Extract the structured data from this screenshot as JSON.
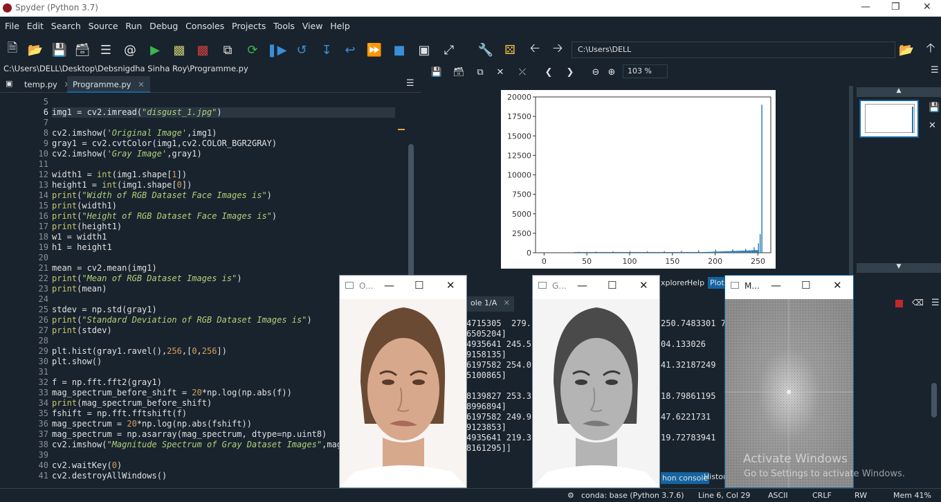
{
  "window": {
    "title": "Spyder (Python 3.7)"
  },
  "menu": [
    "File",
    "Edit",
    "Search",
    "Source",
    "Run",
    "Debug",
    "Consoles",
    "Projects",
    "Tools",
    "View",
    "Help"
  ],
  "toolbar": {
    "path": "C:\\Users\\DELL"
  },
  "editor": {
    "path": "C:\\Users\\DELL\\Desktop\\Debsnigdha Sinha Roy\\Programme.py",
    "tabs": [
      "temp.py",
      "Programme.py"
    ],
    "lines": [
      {
        "n": "5",
        "t": ""
      },
      {
        "n": "6",
        "t": "img1 = cv2.imread(\"disgust_1.jpg\")"
      },
      {
        "n": "7",
        "t": ""
      },
      {
        "n": "8",
        "t": "cv2.imshow('Original Image',img1)"
      },
      {
        "n": "9",
        "t": "gray1 = cv2.cvtColor(img1,cv2.COLOR_BGR2GRAY)"
      },
      {
        "n": "10",
        "t": "cv2.imshow('Gray Image',gray1)"
      },
      {
        "n": "11",
        "t": ""
      },
      {
        "n": "12",
        "t": "width1 = int(img1.shape[1])"
      },
      {
        "n": "13",
        "t": "height1 = int(img1.shape[0])"
      },
      {
        "n": "14",
        "t": "print(\"Width of RGB Dataset Face Images is\")"
      },
      {
        "n": "15",
        "t": "print(width1)"
      },
      {
        "n": "16",
        "t": "print(\"Height of RGB Dataset Face Images is\")"
      },
      {
        "n": "17",
        "t": "print(height1)"
      },
      {
        "n": "18",
        "t": "w1 = width1"
      },
      {
        "n": "19",
        "t": "h1 = height1"
      },
      {
        "n": "20",
        "t": ""
      },
      {
        "n": "21",
        "t": "mean = cv2.mean(img1)"
      },
      {
        "n": "22",
        "t": "print(\"Mean of RGB Dataset Images is\")"
      },
      {
        "n": "23",
        "t": "print(mean)"
      },
      {
        "n": "24",
        "t": ""
      },
      {
        "n": "25",
        "t": "stdev = np.std(gray1)"
      },
      {
        "n": "26",
        "t": "print(\"Standard Deviation of RGB Dataset Images is\")"
      },
      {
        "n": "27",
        "t": "print(stdev)"
      },
      {
        "n": "28",
        "t": ""
      },
      {
        "n": "29",
        "t": "plt.hist(gray1.ravel(),256,[0,256])"
      },
      {
        "n": "30",
        "t": "plt.show()"
      },
      {
        "n": "31",
        "t": ""
      },
      {
        "n": "32",
        "t": "f = np.fft.fft2(gray1)"
      },
      {
        "n": "33",
        "t": "mag_spectrum_before_shift = 20*np.log(np.abs(f))"
      },
      {
        "n": "34",
        "t": "print(mag_spectrum_before_shift)"
      },
      {
        "n": "35",
        "t": "fshift = np.fft.fftshift(f)"
      },
      {
        "n": "36",
        "t": "mag_spectrum = 20*np.log(np.abs(fshift))"
      },
      {
        "n": "37",
        "t": "mag_spectrum = np.asarray(mag_spectrum, dtype=np.uint8)"
      },
      {
        "n": "38",
        "t": "cv2.imshow(\"Magnitude Spectrum of Gray Dataset Images\",mag_"
      },
      {
        "n": "39",
        "t": ""
      },
      {
        "n": "40",
        "t": "cv2.waitKey(0)"
      },
      {
        "n": "41",
        "t": "cv2.destroyAllWindows()"
      }
    ]
  },
  "plots": {
    "zoom": "103 %",
    "panes": [
      "xplorer",
      "Help",
      "Plots"
    ]
  },
  "chart_data": {
    "type": "bar",
    "title": "",
    "xlim": [
      -10,
      265
    ],
    "ylim": [
      0,
      20000
    ],
    "xticks": [
      "0",
      "50",
      "100",
      "150",
      "200",
      "250"
    ],
    "yticks": [
      "0",
      "2500",
      "5000",
      "7500",
      "10000",
      "12500",
      "15000",
      "17500",
      "20000"
    ],
    "bins": [
      {
        "x": 40,
        "y": 120
      },
      {
        "x": 60,
        "y": 150
      },
      {
        "x": 80,
        "y": 160
      },
      {
        "x": 100,
        "y": 170
      },
      {
        "x": 120,
        "y": 180
      },
      {
        "x": 140,
        "y": 200
      },
      {
        "x": 160,
        "y": 230
      },
      {
        "x": 180,
        "y": 300
      },
      {
        "x": 200,
        "y": 380
      },
      {
        "x": 220,
        "y": 420
      },
      {
        "x": 235,
        "y": 500
      },
      {
        "x": 245,
        "y": 700
      },
      {
        "x": 250,
        "y": 1200
      },
      {
        "x": 252,
        "y": 2400
      },
      {
        "x": 254,
        "y": 19000
      }
    ],
    "color": "#1f77b4"
  },
  "windows": {
    "original": {
      "title": "O..."
    },
    "gray": {
      "title": "G..."
    },
    "magnitude": {
      "title": "M..."
    }
  },
  "console": {
    "tab": "ole 1/A",
    "lines": [
      "4715305  279.",
      "6505204]",
      "4935641 245.5",
      "9158135]",
      "6197582 254.0",
      "5100865]",
      "",
      "8139827 253.3",
      "8996894]",
      "6197582 249.9",
      "9123853]",
      "4935641 219.3",
      "8161295]]"
    ],
    "right_lines": [
      "250.7483301 7 2",
      "",
      "04.133026    26",
      "",
      "41.32187249  25",
      "",
      "",
      "18.79861195  22",
      "",
      "47.6221731   23",
      "",
      "19.72783941  25",
      ""
    ],
    "bottom_tabs": [
      "hon console",
      "Histor"
    ]
  },
  "watermark": {
    "line1": "Activate Windows",
    "line2": "Go to Settings to activate Windows."
  },
  "status": {
    "env": "conda: base (Python 3.7.6)",
    "pos": "Line 6, Col 29",
    "enc": "ASCII",
    "eol": "CRLF",
    "rw": "RW",
    "mem": "Mem 41%"
  }
}
